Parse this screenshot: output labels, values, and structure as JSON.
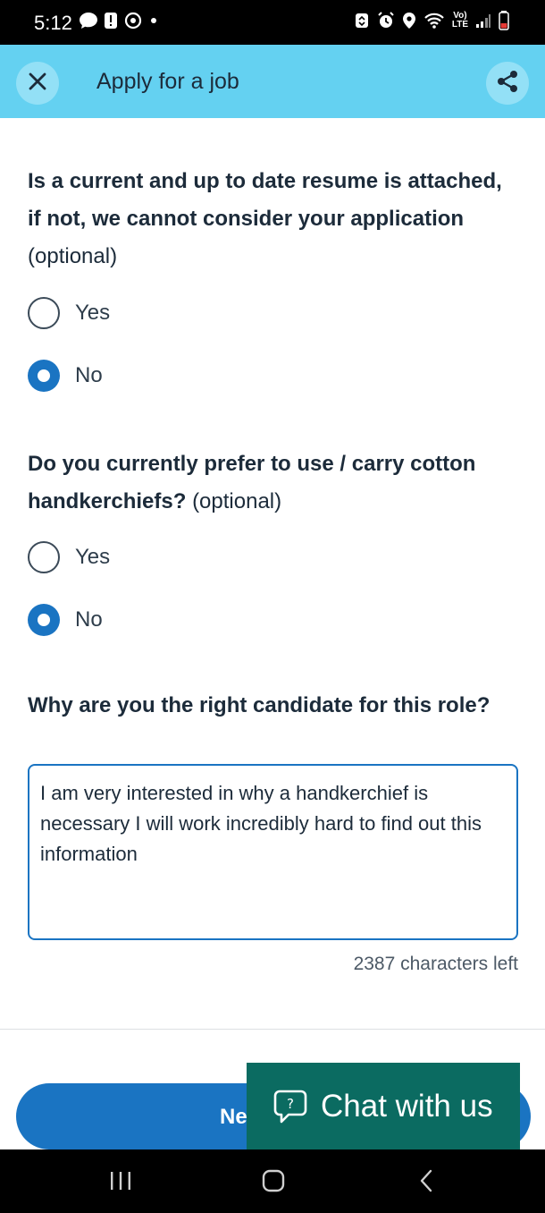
{
  "status_bar": {
    "time": "5:12",
    "lte_label": "Vo)\nLTE",
    "icons": [
      "chat-bubble-icon",
      "alert-icon",
      "sync-icon",
      "dot-icon",
      "recycle-icon",
      "alarm-icon",
      "location-icon",
      "wifi-icon",
      "signal-icon",
      "battery-icon"
    ]
  },
  "app_bar": {
    "title": "Apply for a job",
    "close_icon": "close-icon",
    "share_icon": "share-icon",
    "background": "#64d1f1"
  },
  "questions": [
    {
      "text": "Is a current and up to date resume is attached, if not, we cannot consider your application",
      "optional_label": "(optional)",
      "options": [
        {
          "label": "Yes",
          "selected": false
        },
        {
          "label": "No",
          "selected": true
        }
      ]
    },
    {
      "text": "Do you currently prefer to use / carry cotton handkerchiefs?",
      "optional_label": "(optional)",
      "options": [
        {
          "label": "Yes",
          "selected": false
        },
        {
          "label": "No",
          "selected": true
        }
      ]
    },
    {
      "text": "Why are you the right candidate for this role?",
      "answer": "I am very interested in why a handkerchief is necessary I will work incredibly hard to find out this information",
      "characters_left": "2387 characters left"
    }
  ],
  "footer": {
    "next_label_visible": "Ne",
    "chat_label": "Chat with us",
    "chat_icon": "help-chat-icon",
    "accent": "#1a74c2",
    "chat_color": "#0b6b61"
  },
  "nav_bar": {
    "items": [
      "recent-apps-icon",
      "home-icon",
      "back-icon"
    ]
  }
}
